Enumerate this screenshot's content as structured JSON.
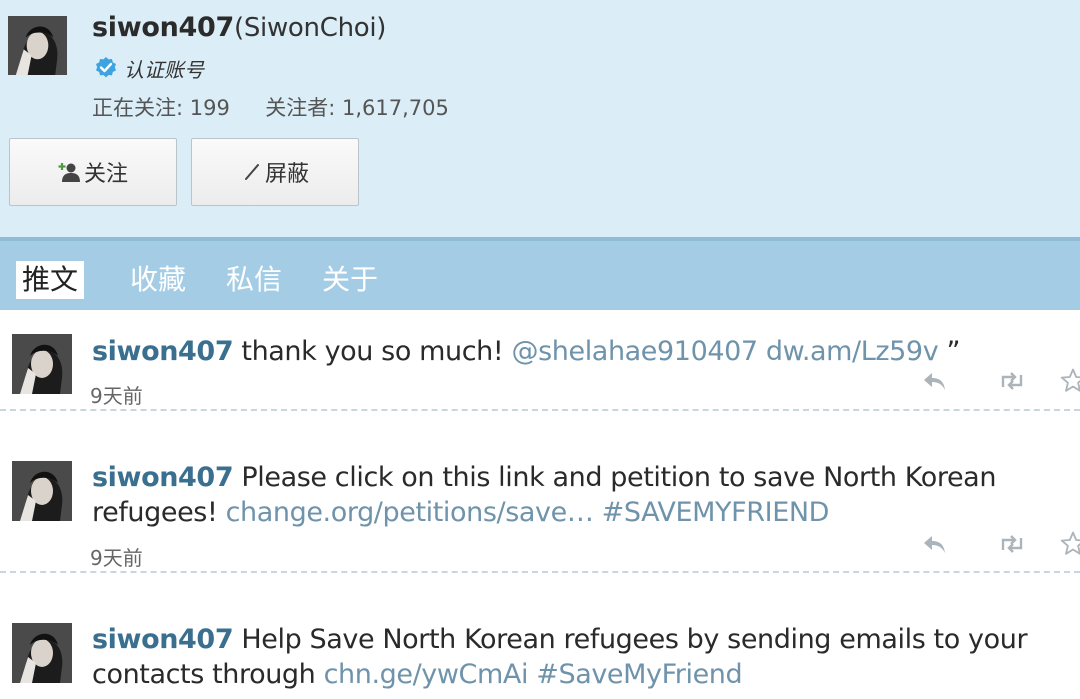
{
  "profile": {
    "username": "siwon407",
    "display_name": "(SiwonChoi)",
    "verified_label": "认证账号",
    "following_label": "正在关注:",
    "following_count": "199",
    "followers_label": "关注者:",
    "followers_count": "1,617,705",
    "follow_button": "关注",
    "block_button": "屏蔽",
    "avatar_icon": "user-photo"
  },
  "tabs": [
    {
      "label": "推文",
      "active": true
    },
    {
      "label": "收藏",
      "active": false
    },
    {
      "label": "私信",
      "active": false
    },
    {
      "label": "关于",
      "active": false
    }
  ],
  "tweets": [
    {
      "author": "siwon407",
      "text_1": "thank you so much!",
      "link_1": "@shelahae910407 dw.am/Lz59v",
      "suffix_1": "”",
      "time": "9天前"
    },
    {
      "author": "siwon407",
      "text_1": "Please click on this link and petition to save North Korean",
      "text_2": "refugees!",
      "link_2": "change.org/petitions/save… #SAVEMYFRIEND",
      "time": "9天前"
    },
    {
      "author": "siwon407",
      "text_1": "Help Save North Korean refugees by sending emails to your",
      "text_2": "contacts through",
      "link_2": "chn.ge/ywCmAi #SaveMyFriend"
    }
  ],
  "colors": {
    "profile_bg": "#dbedf6",
    "tabbar_bg": "#a4cde5",
    "author_blue": "#3a6f8f",
    "link_blue": "#6e93ab",
    "verified_badge": "#3ea3e0"
  },
  "icons": [
    "verified-icon",
    "add-user-icon",
    "block-icon",
    "reply-icon",
    "retweet-icon",
    "favorite-star-icon"
  ]
}
